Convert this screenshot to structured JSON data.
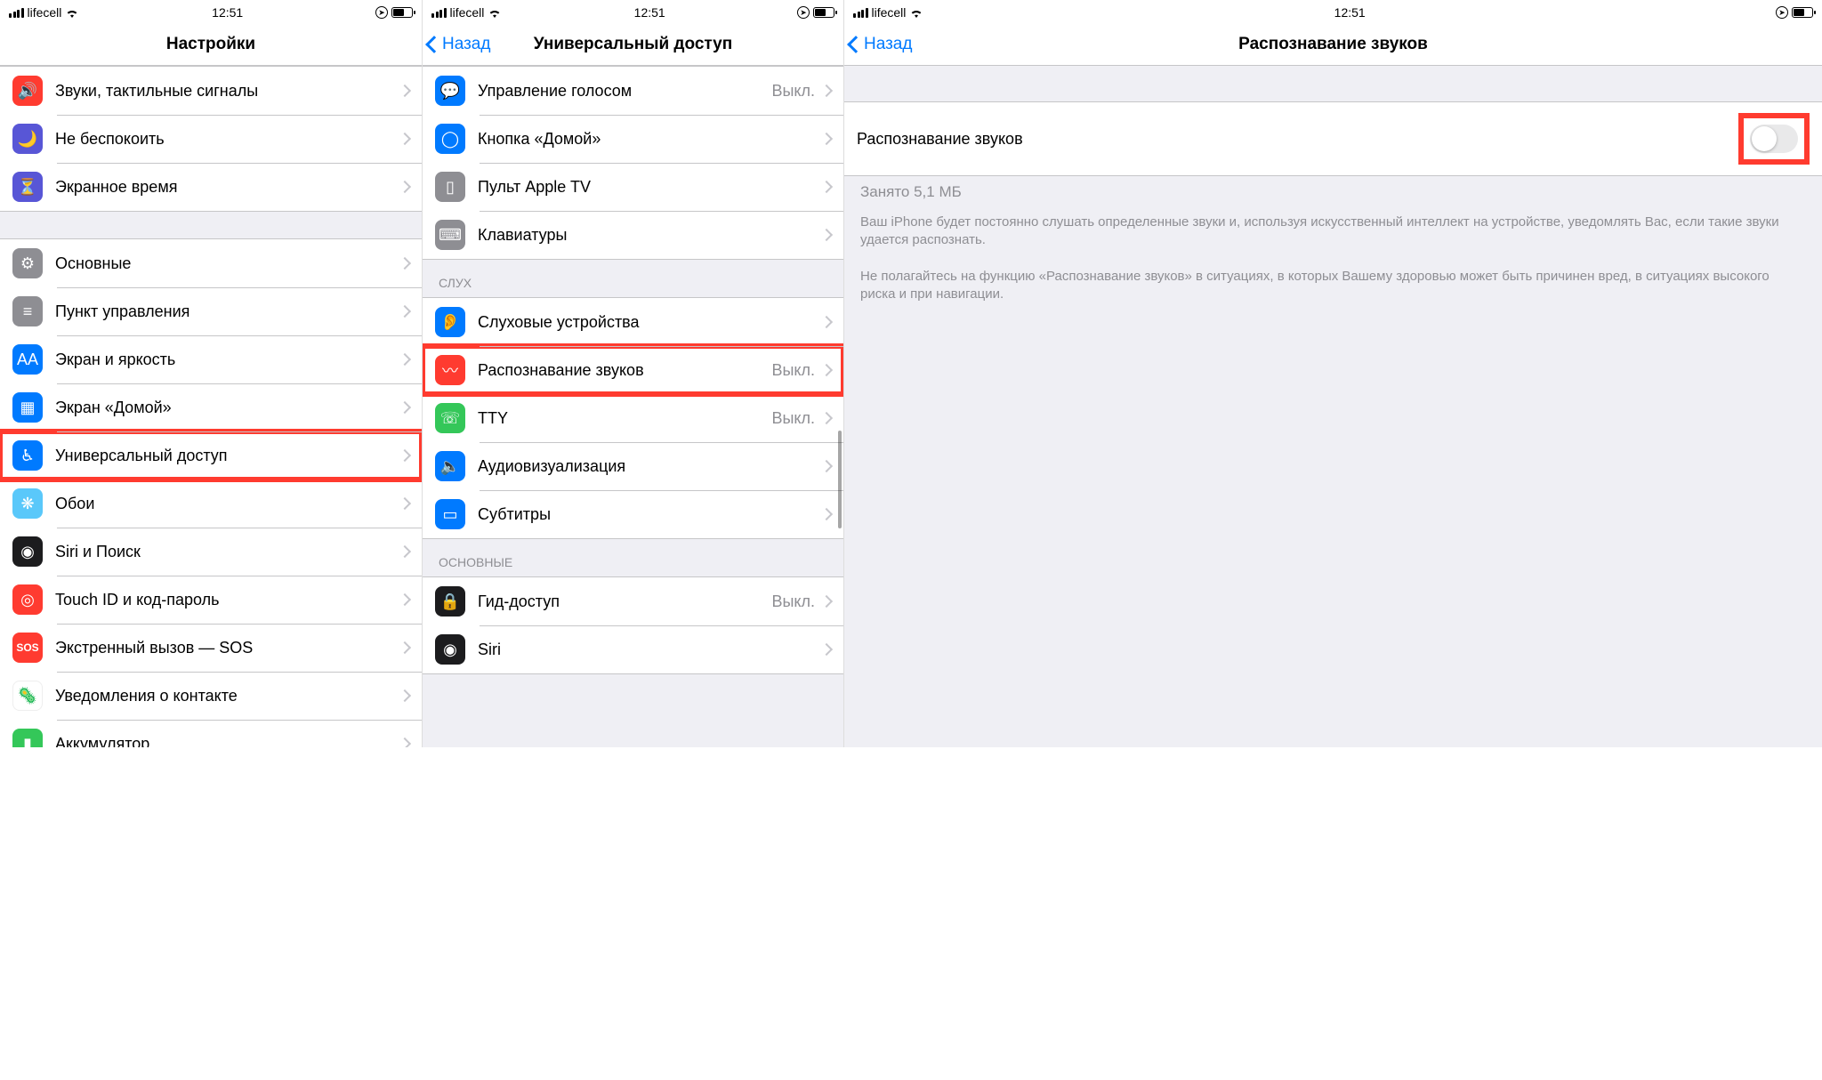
{
  "status": {
    "carrier": "lifecell",
    "time": "12:51"
  },
  "p1": {
    "title": "Настройки",
    "rows": [
      {
        "label": "Звуки, тактильные сигналы"
      },
      {
        "label": "Не беспокоить"
      },
      {
        "label": "Экранное время"
      }
    ],
    "rows2": [
      {
        "label": "Основные"
      },
      {
        "label": "Пункт управления"
      },
      {
        "label": "Экран и яркость"
      },
      {
        "label": "Экран «Домой»"
      },
      {
        "label": "Универсальный доступ"
      },
      {
        "label": "Обои"
      },
      {
        "label": "Siri и Поиск"
      },
      {
        "label": "Touch ID и код-пароль"
      },
      {
        "label": "Экстренный вызов — SOS"
      },
      {
        "label": "Уведомления о контакте"
      },
      {
        "label": "Аккумулятор"
      }
    ]
  },
  "p2": {
    "back": "Назад",
    "title": "Универсальный доступ",
    "rowsA": [
      {
        "label": "Управление голосом",
        "val": "Выкл."
      },
      {
        "label": "Кнопка «Домой»"
      },
      {
        "label": "Пульт Apple TV"
      },
      {
        "label": "Клавиатуры"
      }
    ],
    "secB": "СЛУХ",
    "rowsB": [
      {
        "label": "Слуховые устройства"
      },
      {
        "label": "Распознавание звуков",
        "val": "Выкл."
      },
      {
        "label": "TTY",
        "val": "Выкл."
      },
      {
        "label": "Аудиовизуализация"
      },
      {
        "label": "Субтитры"
      }
    ],
    "secC": "ОСНОВНЫЕ",
    "rowsC": [
      {
        "label": "Гид-доступ",
        "val": "Выкл."
      },
      {
        "label": "Siri"
      }
    ]
  },
  "p3": {
    "back": "Назад",
    "title": "Распознавание звуков",
    "toggle_label": "Распознавание звуков",
    "storage": "Занято 5,1 МБ",
    "desc1": "Ваш iPhone будет постоянно слушать определенные звуки и, используя искусственный интеллект на устройстве, уведомлять Вас, если такие звуки удается распознать.",
    "desc2": "Не полагайтесь на функцию «Распознавание звуков» в ситуациях, в которых Вашему здоровью может быть причинен вред, в ситуациях высокого риска и при навигации."
  }
}
